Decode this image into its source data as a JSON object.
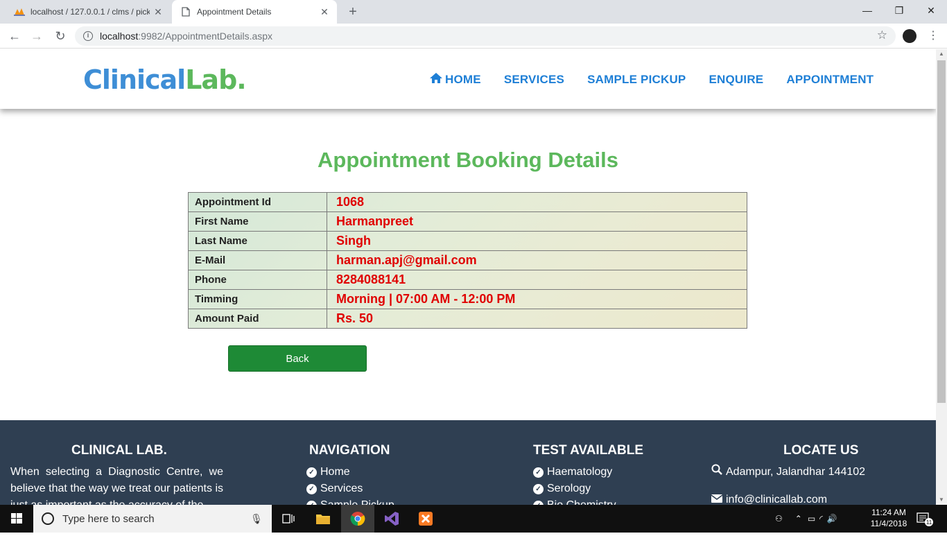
{
  "browser": {
    "tabs": [
      {
        "title": "localhost / 127.0.0.1 / clms / pick",
        "active": false
      },
      {
        "title": "Appointment Details",
        "active": true
      }
    ],
    "url_host": "localhost",
    "url_path": ":9982/AppointmentDetails.aspx"
  },
  "site": {
    "logo_part1": "Clinical",
    "logo_part2": "Lab.",
    "nav": [
      "HOME",
      "SERVICES",
      "SAMPLE PICKUP",
      "ENQUIRE",
      "APPOINTMENT"
    ]
  },
  "page": {
    "title": "Appointment Booking Details",
    "rows": [
      {
        "label": "Appointment Id",
        "value": "1068"
      },
      {
        "label": "First Name",
        "value": "Harmanpreet"
      },
      {
        "label": "Last Name",
        "value": "Singh"
      },
      {
        "label": "E-Mail",
        "value": "harman.apj@gmail.com"
      },
      {
        "label": "Phone",
        "value": "8284088141"
      },
      {
        "label": "Timming",
        "value": "Morning | 07:00 AM - 12:00 PM"
      },
      {
        "label": "Amount Paid",
        "value": "Rs. 50"
      }
    ],
    "back_label": "Back"
  },
  "footer": {
    "about_heading": "CLINICAL LAB.",
    "about_text": "When selecting a Diagnostic Centre, we believe that the way we treat our patients is just as important as the accuracy of the",
    "nav_heading": "NAVIGATION",
    "nav_items": [
      "Home",
      "Services",
      "Sample Pickup"
    ],
    "tests_heading": "TEST AVAILABLE",
    "tests_items": [
      "Haematology",
      "Serology",
      "Bio Chemistry"
    ],
    "locate_heading": "LOCATE US",
    "address": "Adampur, Jalandhar 144102",
    "email": "info@clinicallab.com"
  },
  "taskbar": {
    "search_placeholder": "Type here to search",
    "time": "11:24 AM",
    "date": "11/4/2018",
    "notification_count": "11"
  },
  "colors": {
    "brand_blue": "#3e8ed6",
    "brand_green": "#5cb85c",
    "value_red": "#e00000",
    "button_green": "#1e8a36",
    "footer_bg": "#2f3f52"
  }
}
